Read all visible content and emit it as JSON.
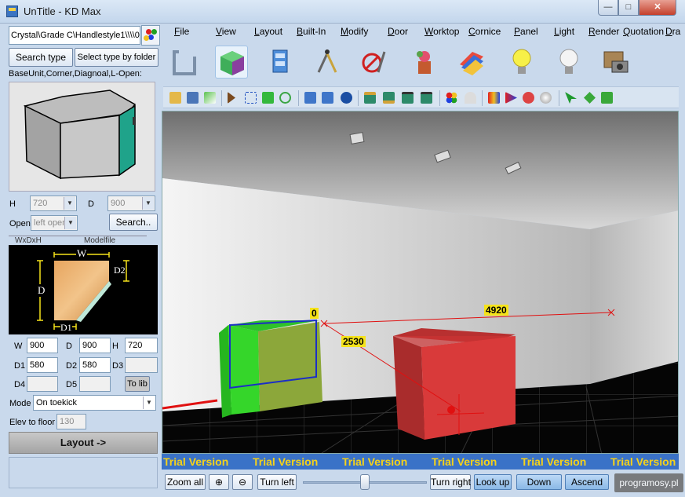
{
  "window": {
    "title": "UnTitle - KD Max"
  },
  "left_panel": {
    "path": "Crystal\\Grade C\\Handlestyle1\\\\\\\\0",
    "search_type_label": "Search type",
    "select_by_folder_label": "Select type by folder",
    "category_label": "BaseUnit,Corner,Diagnoal,L-Open:",
    "h_label": "H",
    "h_value": "720",
    "d_label": "D",
    "d_value": "900",
    "open_label": "Open",
    "open_value": "left open",
    "search_button": "Search..",
    "tabs": [
      "WxDxH",
      "Modelfile"
    ],
    "diagram_labels": {
      "w": "W",
      "d": "D",
      "d1": "D1",
      "d2": "D2"
    },
    "params": {
      "w_label": "W",
      "w_value": "900",
      "d_label": "D",
      "d_value": "900",
      "h_label": "H",
      "h_value": "720",
      "d1_label": "D1",
      "d1_value": "580",
      "d2_label": "D2",
      "d2_value": "580",
      "d3_label": "D3",
      "d4_label": "D4",
      "d5_label": "D5",
      "to_lib": "To lib"
    },
    "mode_label": "Mode",
    "mode_value": "On toekick",
    "elev_label": "Elev to floor",
    "elev_value": "130",
    "layout_button": "Layout ->"
  },
  "menu": [
    "File",
    "View",
    "Layout",
    "Built-In",
    "Modify",
    "Door",
    "Worktop",
    "Cornice",
    "Panel",
    "Light",
    "Render",
    "Quotation",
    "Dra"
  ],
  "viewport": {
    "dim_top": "4920",
    "dim_side": "2530",
    "dim_zero": "0",
    "trial_text": "Trial Version"
  },
  "bottom_bar": {
    "zoom_all": "Zoom all",
    "turn_left": "Turn left",
    "turn_right": "Turn right",
    "look_up": "Look up",
    "down": "Down",
    "ascend": "Ascend"
  },
  "watermark": "programosy.pl",
  "colors": {
    "accent": "#3a72c7",
    "trial_text": "#f5d21a",
    "cabinet_green": "#2fd52a",
    "cabinet_red": "#d93a3a"
  }
}
